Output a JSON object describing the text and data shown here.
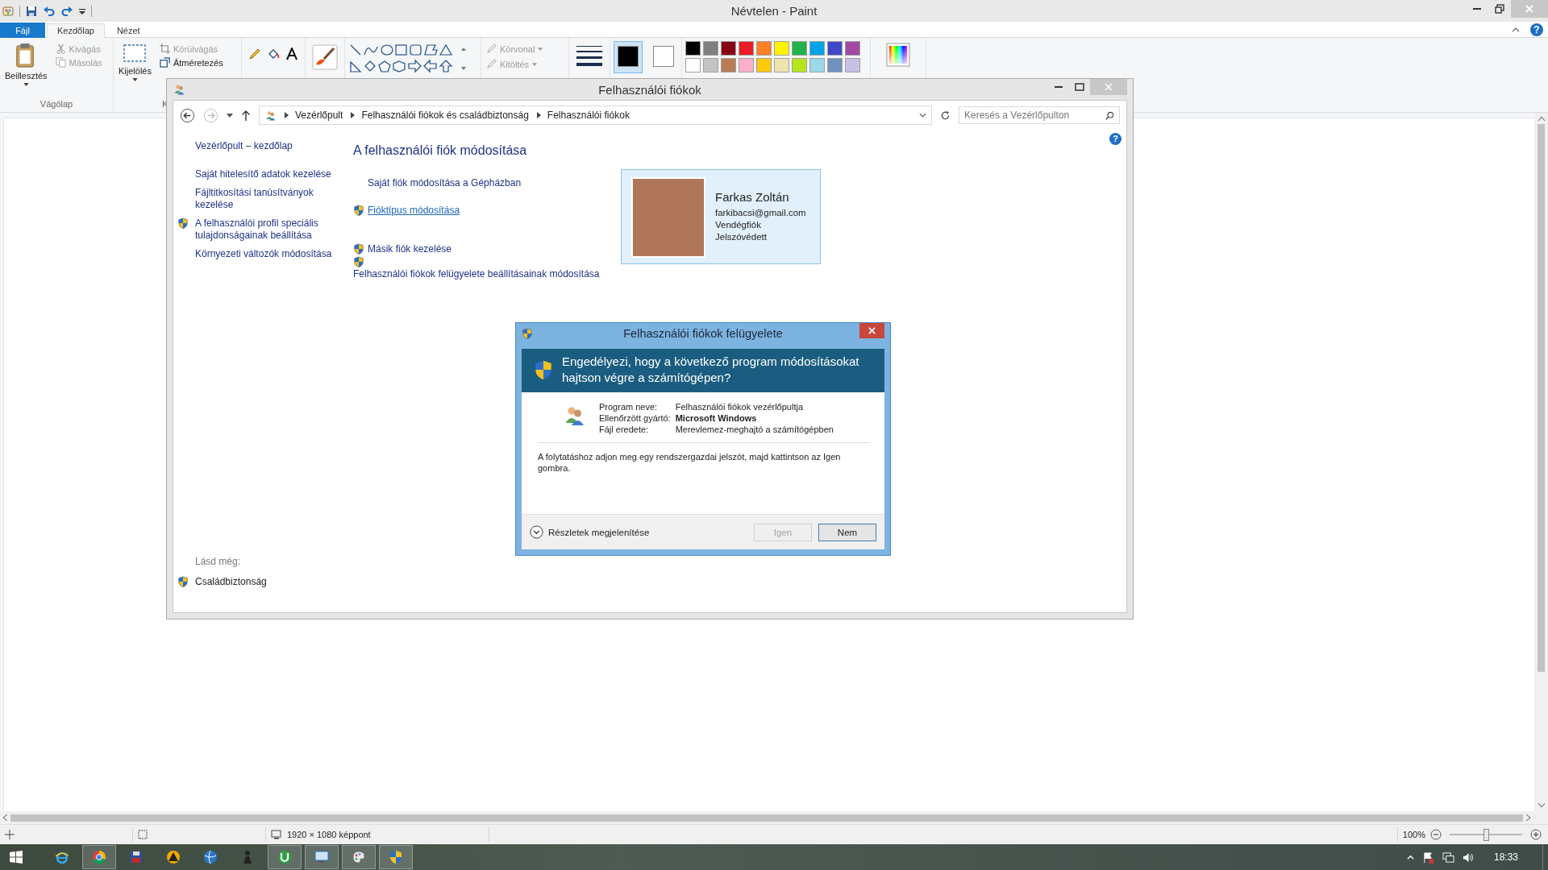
{
  "paint": {
    "title": "Névtelen - Paint",
    "help": "?",
    "tabs": [
      {
        "label": "Fájl",
        "kind": "file",
        "selected": false
      },
      {
        "label": "Kezdőlap",
        "kind": "tab",
        "selected": true
      },
      {
        "label": "Nézet",
        "kind": "tab",
        "selected": false
      }
    ],
    "clipboard": {
      "group": "Vágólap",
      "paste": "Beillesztés",
      "cut": {
        "label": "Kivágás",
        "disabled": true
      },
      "copy": {
        "label": "Másolás",
        "disabled": true
      }
    },
    "image": {
      "group": "K",
      "select": "Kijelölés",
      "crop": {
        "label": "Körülvágás",
        "disabled": true
      },
      "resize": {
        "label": "Átméretezés",
        "disabled": false
      }
    },
    "shape_style": [
      {
        "label": "Körvonal",
        "disabled": true
      },
      {
        "label": "Kitöltés",
        "disabled": true
      }
    ],
    "colors": [
      {
        "color": "#000000",
        "selected": true
      },
      {
        "color": "#ffffff",
        "selected": false
      }
    ],
    "palette": [
      {
        "color": "#000000"
      },
      {
        "color": "#7f7f7f"
      },
      {
        "color": "#880015"
      },
      {
        "color": "#ed1c24"
      },
      {
        "color": "#ff7f27"
      },
      {
        "color": "#fff200"
      },
      {
        "color": "#22b14c"
      },
      {
        "color": "#00a2e8"
      },
      {
        "color": "#3f48cc"
      },
      {
        "color": "#a349a4"
      },
      {
        "color": "#ffffff"
      },
      {
        "color": "#c3c3c3"
      },
      {
        "color": "#b97a57"
      },
      {
        "color": "#ffaec9"
      },
      {
        "color": "#ffc90e"
      },
      {
        "color": "#efe4b0"
      },
      {
        "color": "#b5e61d"
      },
      {
        "color": "#99d9ea"
      },
      {
        "color": "#7092be"
      },
      {
        "color": "#c8bfe7"
      }
    ],
    "status": {
      "dimensions": "1920 × 1080 képpont",
      "zoom": "100%",
      "zoom_slider": {
        "level": 0.5
      }
    }
  },
  "control_panel": {
    "title": "Felhasználói fiókok",
    "help": "?",
    "breadcrumbs": [
      "Vezérlőpult",
      "Felhasználói fiókok és családbiztonság",
      "Felhasználói fiókok"
    ],
    "search": {
      "placeholder": "Keresés a Vezérlőpulton"
    },
    "sidebar": {
      "items": [
        {
          "label": "Vezérlőpult – kezdőlap",
          "shield": false
        },
        {
          "label": "Saját hitelesítő adatok kezelése",
          "shield": false
        },
        {
          "label": "Fájltitkosítási tanúsítványok kezelése",
          "shield": false
        },
        {
          "label": "A felhasználói profil speciális tulajdonságainak beállítása",
          "shield": true
        },
        {
          "label": "Környezeti változók módosítása",
          "shield": false
        }
      ],
      "see_also_label": "Lásd még:",
      "see_also": [
        {
          "label": "Családbiztonság",
          "shield": true
        }
      ]
    },
    "heading": "A felhasználói fiók módosítása",
    "links": [
      {
        "label": "Saját fiók módosítása a Gépházban",
        "shield": false,
        "hovered": false,
        "stacked": false
      },
      {
        "label": "Fióktípus módosítása",
        "shield": true,
        "hovered": true,
        "stacked": false
      },
      {
        "label": "Másik fiók kezelése",
        "shield": true,
        "hovered": false,
        "stacked": false
      },
      {
        "label": "Felhasználói fiókok felügyelete beállításainak módosítása",
        "shield": true,
        "hovered": false,
        "stacked": true
      }
    ],
    "account": {
      "name": "Farkas Zoltán",
      "email": "farkibacsi@gmail.com",
      "type": "Vendégfiók",
      "protection": "Jelszóvédett"
    }
  },
  "uac": {
    "title": "Felhasználói fiókok felügyelete",
    "question": "Engedélyezi, hogy a következő program módosításokat hajtson végre a számítógépen?",
    "details": [
      {
        "label": "Program neve:",
        "value": "Felhasználói fiókok vezérlőpultja",
        "emphasis": false
      },
      {
        "label": "Ellenőrzött gyártó:",
        "value": "Microsoft Windows",
        "emphasis": true
      },
      {
        "label": "Fájl eredete:",
        "value": "Merevlemez-meghajtó a számítógépben",
        "emphasis": false
      }
    ],
    "instruction": "A folytatáshoz adjon meg egy rendszergazdai jelszót, majd kattintson az Igen gombra.",
    "details_toggle": "Részletek megjelenítése",
    "buttons": [
      {
        "label": "Igen",
        "disabled": true,
        "default": false
      },
      {
        "label": "Nem",
        "disabled": false,
        "default": true
      }
    ]
  },
  "taskbar": {
    "items": [
      {
        "kind": "browser-e",
        "active": false
      },
      {
        "kind": "browser-ring",
        "active": true
      },
      {
        "kind": "floppy",
        "active": false
      },
      {
        "kind": "triangle",
        "active": false
      },
      {
        "kind": "globe",
        "active": false
      },
      {
        "kind": "figure",
        "active": false
      },
      {
        "kind": "torrent",
        "active": true
      },
      {
        "kind": "monitor",
        "active": true
      },
      {
        "kind": "palette",
        "active": true
      },
      {
        "kind": "shield",
        "active": true
      }
    ],
    "clock": "18:33"
  }
}
